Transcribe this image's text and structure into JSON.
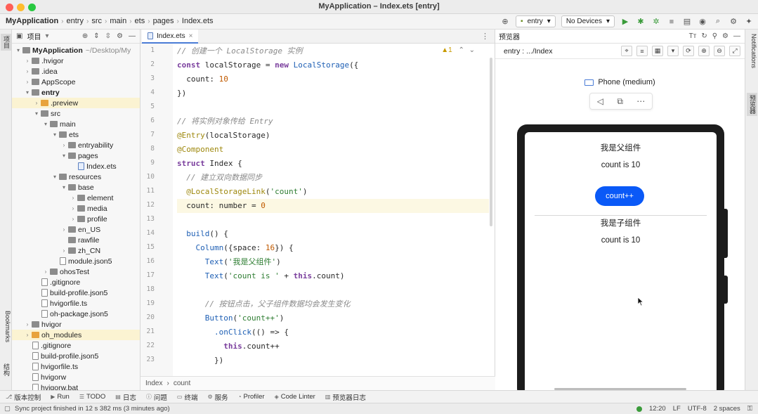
{
  "window": {
    "title": "MyApplication – Index.ets [entry]",
    "traffic_colors": [
      "#ff5f57",
      "#febc2e",
      "#28c840"
    ]
  },
  "breadcrumb": [
    "MyApplication",
    "entry",
    "src",
    "main",
    "ets",
    "pages",
    "Index.ets"
  ],
  "toolbar": {
    "module_select": "entry",
    "device_select": "No Devices",
    "run_color": "#3a9b3a"
  },
  "left_strip": {
    "project_tab": "项目",
    "bookmarks_tab": "Bookmarks",
    "structure_tab": "结构"
  },
  "project": {
    "header_label": "项目",
    "tree": [
      {
        "label": "MyApplication",
        "sub": "~/Desktop/My",
        "depth": 0,
        "kind": "folder",
        "open": true,
        "bold": true
      },
      {
        "label": ".hvigor",
        "depth": 1,
        "kind": "folder"
      },
      {
        "label": ".idea",
        "depth": 1,
        "kind": "folder"
      },
      {
        "label": "AppScope",
        "depth": 1,
        "kind": "folder"
      },
      {
        "label": "entry",
        "depth": 1,
        "kind": "folder",
        "open": true,
        "bold": true
      },
      {
        "label": ".preview",
        "depth": 2,
        "kind": "folder-orange",
        "hl": true
      },
      {
        "label": "src",
        "depth": 2,
        "kind": "folder",
        "open": true
      },
      {
        "label": "main",
        "depth": 3,
        "kind": "folder",
        "open": true
      },
      {
        "label": "ets",
        "depth": 4,
        "kind": "folder",
        "open": true
      },
      {
        "label": "entryability",
        "depth": 5,
        "kind": "folder"
      },
      {
        "label": "pages",
        "depth": 5,
        "kind": "folder",
        "open": true
      },
      {
        "label": "Index.ets",
        "depth": 6,
        "kind": "file-blue"
      },
      {
        "label": "resources",
        "depth": 4,
        "kind": "folder",
        "open": true
      },
      {
        "label": "base",
        "depth": 5,
        "kind": "folder",
        "open": true
      },
      {
        "label": "element",
        "depth": 6,
        "kind": "folder"
      },
      {
        "label": "media",
        "depth": 6,
        "kind": "folder"
      },
      {
        "label": "profile",
        "depth": 6,
        "kind": "folder"
      },
      {
        "label": "en_US",
        "depth": 5,
        "kind": "folder"
      },
      {
        "label": "rawfile",
        "depth": 5,
        "kind": "folder-leaf"
      },
      {
        "label": "zh_CN",
        "depth": 5,
        "kind": "folder"
      },
      {
        "label": "module.json5",
        "depth": 4,
        "kind": "file"
      },
      {
        "label": "ohosTest",
        "depth": 3,
        "kind": "folder"
      },
      {
        "label": ".gitignore",
        "depth": 2,
        "kind": "file"
      },
      {
        "label": "build-profile.json5",
        "depth": 2,
        "kind": "file"
      },
      {
        "label": "hvigorfile.ts",
        "depth": 2,
        "kind": "file"
      },
      {
        "label": "oh-package.json5",
        "depth": 2,
        "kind": "file"
      },
      {
        "label": "hvigor",
        "depth": 1,
        "kind": "folder"
      },
      {
        "label": "oh_modules",
        "depth": 1,
        "kind": "folder-orange",
        "hl": true
      },
      {
        "label": ".gitignore",
        "depth": 1,
        "kind": "file"
      },
      {
        "label": "build-profile.json5",
        "depth": 1,
        "kind": "file"
      },
      {
        "label": "hvigorfile.ts",
        "depth": 1,
        "kind": "file"
      },
      {
        "label": "hvigorw",
        "depth": 1,
        "kind": "file"
      },
      {
        "label": "hvigorw.bat",
        "depth": 1,
        "kind": "file"
      }
    ]
  },
  "editor": {
    "tab_label": "Index.ets",
    "warning_count": "1",
    "current_line": 12,
    "lines": [
      [
        [
          "cm",
          "// 创建一个 LocalStorage 实例"
        ]
      ],
      [
        [
          "kw",
          "const"
        ],
        [
          "",
          " localStorage = "
        ],
        [
          "kw",
          "new"
        ],
        [
          "fn",
          " LocalStorage"
        ],
        [
          "",
          "({"
        ]
      ],
      [
        [
          "",
          "  count: "
        ],
        [
          "nm",
          "10"
        ]
      ],
      [
        [
          "",
          "})"
        ]
      ],
      [
        [
          "",
          ""
        ]
      ],
      [
        [
          "cm",
          "// 将实例对象传给 Entry"
        ]
      ],
      [
        [
          "an",
          "@Entry"
        ],
        [
          "",
          "(localStorage)"
        ]
      ],
      [
        [
          "an",
          "@Component"
        ]
      ],
      [
        [
          "kw",
          "struct"
        ],
        [
          "",
          " Index {"
        ]
      ],
      [
        [
          "cm",
          "  // 建立双向数据同步"
        ]
      ],
      [
        [
          "an",
          "  @LocalStorageLink"
        ],
        [
          "",
          "("
        ],
        [
          "st",
          "'count'"
        ],
        [
          "",
          ")"
        ]
      ],
      [
        [
          "",
          "  count: number = "
        ],
        [
          "nm",
          "0"
        ]
      ],
      [
        [
          "",
          ""
        ]
      ],
      [
        [
          "fn",
          "  build"
        ],
        [
          "",
          "() {"
        ]
      ],
      [
        [
          "fn",
          "    Column"
        ],
        [
          "",
          "({space: "
        ],
        [
          "nm",
          "16"
        ],
        [
          "",
          "}) {"
        ]
      ],
      [
        [
          "fn",
          "      Text"
        ],
        [
          "",
          "("
        ],
        [
          "st",
          "'我是父组件'"
        ],
        [
          "",
          ")"
        ]
      ],
      [
        [
          "fn",
          "      Text"
        ],
        [
          "",
          "("
        ],
        [
          "st",
          "'count is '"
        ],
        [
          "",
          " + "
        ],
        [
          "kw",
          "this"
        ],
        [
          "",
          ".count)"
        ]
      ],
      [
        [
          "",
          ""
        ]
      ],
      [
        [
          "cm",
          "      // 按钮点击，父子组件数据均会发生变化"
        ]
      ],
      [
        [
          "fn",
          "      Button"
        ],
        [
          "",
          "("
        ],
        [
          "st",
          "'count++'"
        ],
        [
          "",
          ")"
        ]
      ],
      [
        [
          "fn",
          "        .onClick"
        ],
        [
          "",
          "(() => {"
        ]
      ],
      [
        [
          "kw",
          "          this"
        ],
        [
          "",
          ".count++"
        ]
      ],
      [
        [
          "",
          "        })"
        ]
      ]
    ],
    "footer_crumb": [
      "Index",
      "count"
    ]
  },
  "previewer": {
    "header_label": "预览器",
    "route": "entry : .../Index",
    "device_name": "Phone (medium)",
    "parent_title": "我是父组件",
    "parent_count": "count is 10",
    "button_label": "count++",
    "button_color": "#0a59f7",
    "child_title": "我是子组件",
    "child_count": "count is 10"
  },
  "right_strip": {
    "notifications_tab": "Notifications",
    "previewer_tab": "预览器"
  },
  "bottom_tools": [
    {
      "icon": "version-control-icon",
      "label": "版本控制"
    },
    {
      "icon": "run-icon",
      "label": "Run"
    },
    {
      "icon": "todo-icon",
      "label": "TODO"
    },
    {
      "icon": "log-icon",
      "label": "日志"
    },
    {
      "icon": "problems-icon",
      "label": "问题"
    },
    {
      "icon": "terminal-icon",
      "label": "终端"
    },
    {
      "icon": "services-icon",
      "label": "服务"
    },
    {
      "icon": "profiler-icon",
      "label": "Profiler"
    },
    {
      "icon": "code-linter-icon",
      "label": "Code Linter"
    },
    {
      "icon": "preview-log-icon",
      "label": "预览器日志"
    }
  ],
  "status": {
    "message": "Sync project finished in 12 s 382 ms (3 minutes ago)",
    "position": "12:20",
    "line_sep": "LF",
    "encoding": "UTF-8",
    "indent": "2 spaces"
  }
}
